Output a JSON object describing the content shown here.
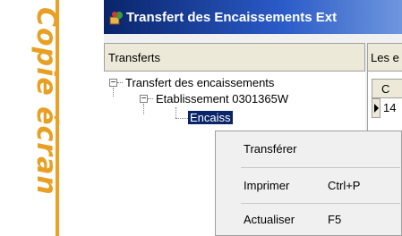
{
  "side_caption": "Copie écran",
  "window": {
    "title": "Transfert des Encaissements Ext",
    "icon": "app-icon"
  },
  "headers": {
    "tree": "Transferts",
    "right": "Les e"
  },
  "tree": {
    "root": "Transfert des encaissements",
    "child": "Etablissement 0301365W",
    "selected": "Encaiss"
  },
  "grid": {
    "col_header": "C",
    "row_value": "14"
  },
  "context_menu": {
    "items": [
      {
        "label": "Transférer",
        "shortcut": ""
      },
      {
        "label": "Imprimer",
        "shortcut": "Ctrl+P"
      },
      {
        "label": "Actualiser",
        "shortcut": "F5"
      }
    ]
  },
  "colors": {
    "caption": "#e8a024",
    "title_bar": "#0a246a",
    "selection": "#0a246a"
  }
}
